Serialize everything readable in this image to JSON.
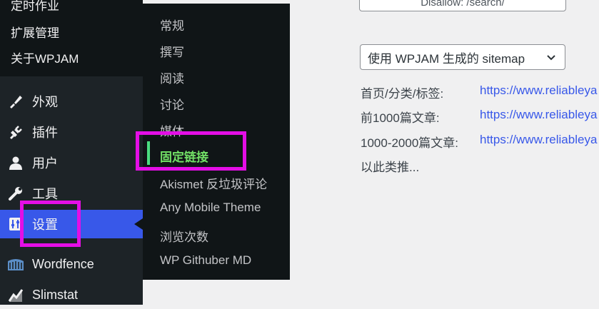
{
  "sidebar": {
    "submenu_top": [
      "定时作业",
      "扩展管理",
      "关于WPJAM"
    ],
    "items": [
      {
        "label": "外观",
        "icon": "paintbrush-icon"
      },
      {
        "label": "插件",
        "icon": "plugin-icon"
      },
      {
        "label": "用户",
        "icon": "user-icon"
      },
      {
        "label": "工具",
        "icon": "wrench-icon"
      },
      {
        "label": "设置",
        "icon": "settings-icon"
      },
      {
        "label": "Wordfence",
        "icon": "wordfence-icon"
      },
      {
        "label": "Slimstat",
        "icon": "chart-icon"
      }
    ]
  },
  "flyout": {
    "items": [
      "常规",
      "撰写",
      "阅读",
      "讨论",
      "媒体",
      "固定链接",
      "Akismet 反垃圾评论",
      "Any Mobile Theme",
      "浏览次数",
      "WP Githuber MD"
    ],
    "active": "固定链接"
  },
  "content": {
    "top_input_value": "Disallow: /search/",
    "sitemap_select": "使用 WPJAM 生成的 sitemap",
    "rows": [
      {
        "label": "首页/分类/标签:",
        "link": "https://www.reliableya"
      },
      {
        "label": "前1000篇文章:",
        "link": "https://www.reliableya"
      },
      {
        "label": "1000-2000篇文章:",
        "link": "https://www.reliableya"
      },
      {
        "label": "以此类推...",
        "link": ""
      }
    ]
  },
  "colors": {
    "sidebar_bg": "#1d2327",
    "flyout_bg": "#101517",
    "current_menu_bg": "#3858e9",
    "active_text": "#72e066",
    "highlight": "#e40ee6",
    "link": "#3858e9"
  }
}
